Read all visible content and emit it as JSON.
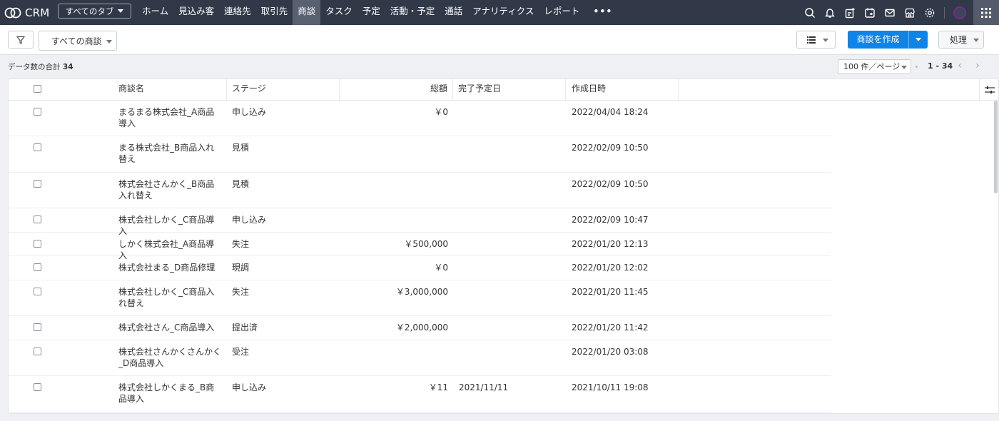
{
  "app": {
    "name": "CRM",
    "all_tabs_label": "すべてのタブ"
  },
  "nav": {
    "tabs": [
      {
        "label": "ホーム",
        "active": false
      },
      {
        "label": "見込み客",
        "active": false
      },
      {
        "label": "連絡先",
        "active": false
      },
      {
        "label": "取引先",
        "active": false
      },
      {
        "label": "商談",
        "active": true
      },
      {
        "label": "タスク",
        "active": false
      },
      {
        "label": "予定",
        "active": false
      },
      {
        "label": "活動・予定",
        "active": false
      },
      {
        "label": "通話",
        "active": false
      },
      {
        "label": "アナリティクス",
        "active": false
      },
      {
        "label": "レポート",
        "active": false
      }
    ],
    "more_label": "•••",
    "icons": [
      "search-icon",
      "bell-icon",
      "new-note-icon",
      "calendar-icon",
      "mail-icon",
      "store-icon",
      "gear-icon"
    ]
  },
  "toolbar": {
    "view_label": "すべての商談",
    "create_label": "商談を作成",
    "action_label": "処理"
  },
  "summary": {
    "label": "データ数の合計",
    "count": "34",
    "per_page": "100 件／ページ",
    "range": "1 - 34"
  },
  "table": {
    "headers": {
      "name": "商談名",
      "stage": "ステージ",
      "amount": "総額",
      "close_date": "完了予定日",
      "created": "作成日時"
    },
    "rows": [
      {
        "name": "まるまる株式会社_A商品導入",
        "stage": "申し込み",
        "amount": "￥0",
        "close_date": "",
        "created": "2022/04/04 18:24"
      },
      {
        "name": "まる株式会社_B商品入れ替え",
        "stage": "見積",
        "amount": "",
        "close_date": "",
        "created": "2022/02/09 10:50"
      },
      {
        "name": "株式会社さんかく_B商品入れ替え",
        "stage": "見積",
        "amount": "",
        "close_date": "",
        "created": "2022/02/09 10:50"
      },
      {
        "name": "株式会社しかく_C商品導入",
        "stage": "申し込み",
        "amount": "",
        "close_date": "",
        "created": "2022/02/09 10:47"
      },
      {
        "name": "しかく株式会社_A商品導入",
        "stage": "失注",
        "amount": "￥500,000",
        "close_date": "",
        "created": "2022/01/20 12:13"
      },
      {
        "name": "株式会社まる_D商品修理",
        "stage": "現調",
        "amount": "￥0",
        "close_date": "",
        "created": "2022/01/20 12:02"
      },
      {
        "name": "株式会社しかく_C商品入れ替え",
        "stage": "失注",
        "amount": "￥3,000,000",
        "close_date": "",
        "created": "2022/01/20 11:45"
      },
      {
        "name": "株式会社さん_C商品導入",
        "stage": "提出済",
        "amount": "￥2,000,000",
        "close_date": "",
        "created": "2022/01/20 11:42"
      },
      {
        "name": "株式会社さんかくさんかく_D商品導入",
        "stage": "受注",
        "amount": "",
        "close_date": "",
        "created": "2022/01/20 03:08"
      },
      {
        "name": "株式会社しかくまる_B商品導入",
        "stage": "申し込み",
        "amount": "￥11",
        "close_date": "2021/11/11",
        "created": "2021/10/11 19:08"
      }
    ]
  },
  "colors": {
    "nav_bg": "#313949",
    "nav_active": "#59606f",
    "primary": "#0f84e8",
    "page_bg": "#eef0f3"
  }
}
